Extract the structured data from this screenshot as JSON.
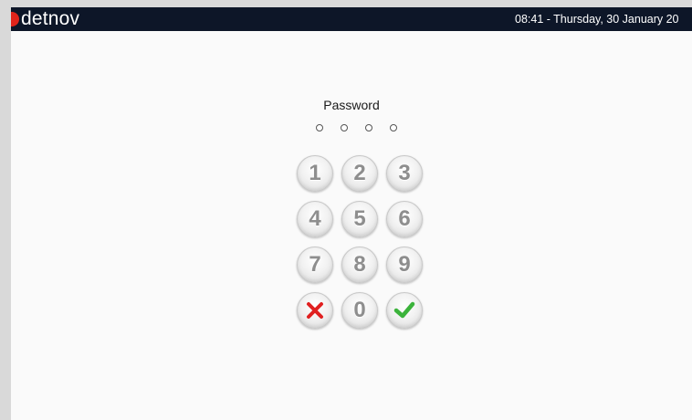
{
  "header": {
    "logo_text": "detnov",
    "datetime": "08:41  -  Thursday, 30 January 20"
  },
  "login": {
    "title": "Password",
    "pin_length": 4,
    "pin_entered": 0
  },
  "keypad": {
    "keys": [
      "1",
      "2",
      "3",
      "4",
      "5",
      "6",
      "7",
      "8",
      "9",
      "0"
    ],
    "cancel_icon": "x-icon",
    "confirm_icon": "check-icon"
  },
  "colors": {
    "header_bg": "#0d1628",
    "logo_accent": "#e0241b",
    "cancel": "#e02020",
    "confirm": "#3bb33b"
  }
}
